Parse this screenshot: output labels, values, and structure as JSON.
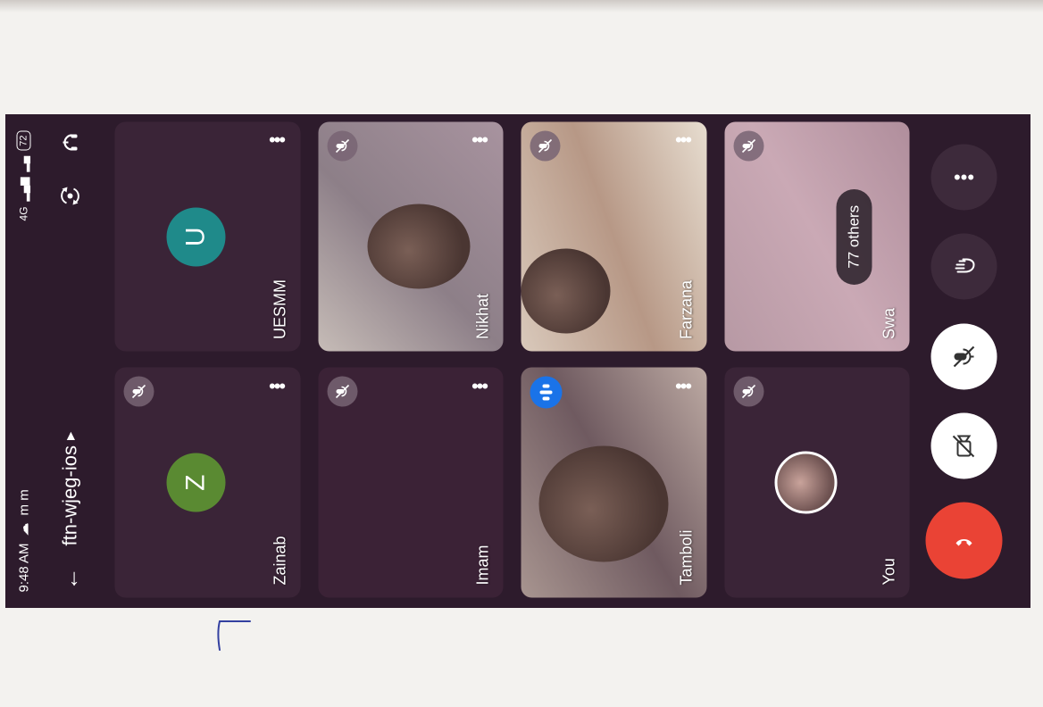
{
  "status": {
    "time": "9:48 AM",
    "extra": "m m",
    "network": "4G",
    "battery": "72"
  },
  "header": {
    "meeting_code": "ftn-wjeg-ios"
  },
  "tiles": [
    {
      "name": "Zainab",
      "initial": "Z",
      "color": "#5a8a32",
      "muted": true
    },
    {
      "name": "UESMM",
      "initial": "U",
      "color": "#1f8a8a",
      "muted": false
    },
    {
      "name": "Imam",
      "muted": true
    },
    {
      "name": "Nikhat",
      "muted": true
    },
    {
      "name": "Tamboli",
      "speaking": true
    },
    {
      "name": "Farzana",
      "muted": true
    },
    {
      "name": "You",
      "muted": true
    },
    {
      "name": "Swa",
      "muted": true,
      "others_label": "77 others"
    }
  ],
  "colors": {
    "end_call": "#ea4335",
    "speaking": "#1a73e8"
  }
}
